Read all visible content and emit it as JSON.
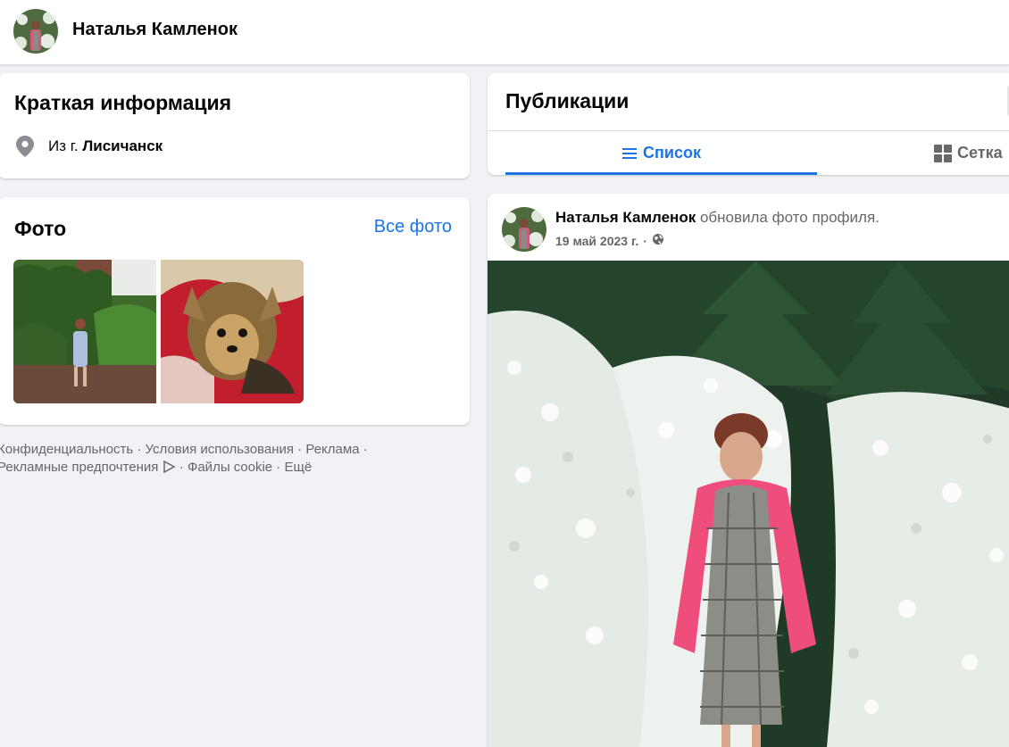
{
  "profile": {
    "name": "Наталья Камленок"
  },
  "intro": {
    "title": "Краткая информация",
    "location_prefix": "Из г. ",
    "location_city": "Лисичанск"
  },
  "photos": {
    "title": "Фото",
    "all_link": "Все фото"
  },
  "footer": {
    "links": [
      "Конфиденциальность",
      "Условия использования",
      "Реклама",
      "Рекламные предпочтения",
      "Файлы cookie",
      "Ещё"
    ],
    "separator": " · "
  },
  "posts": {
    "title": "Публикации",
    "tabs": [
      {
        "label": "Список",
        "icon": "list-icon",
        "active": true
      },
      {
        "label": "Сетка",
        "icon": "grid-icon",
        "active": false
      }
    ]
  },
  "post": {
    "author": "Наталья Камленок",
    "action": " обновила фото профиля.",
    "date": "19 май 2023 г.",
    "dot": "·",
    "privacy_icon": "globe-icon"
  },
  "colors": {
    "accent": "#1b74e4",
    "muted": "#65676b",
    "background": "#f0f2f5"
  }
}
